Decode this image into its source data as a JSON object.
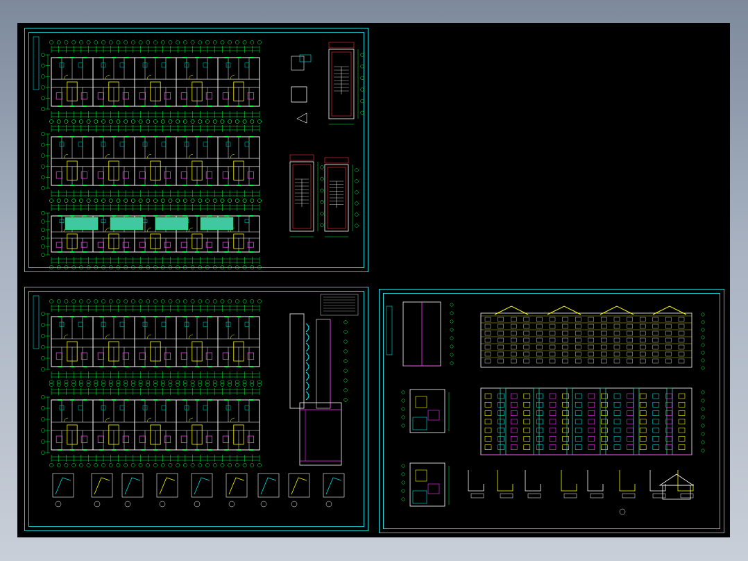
{
  "app": {
    "window": "cad-model-space-viewport",
    "background": "#000000"
  },
  "colors": {
    "wall": "#ffffff",
    "dimension": "#00ff40",
    "axis": "#20d0d8",
    "accent_yellow": "#ffff00",
    "accent_magenta": "#ff30ff",
    "accent_red": "#ff3030",
    "accent_cyan": "#00e0e0",
    "accent_fill": "#40c8a0"
  },
  "sheets": [
    {
      "id": "sheet-floor-plans-a",
      "content": [
        "floor-plan",
        "floor-plan",
        "floor-plan",
        "stair-detail"
      ]
    },
    {
      "id": "sheet-floor-plans-b",
      "content": [
        "floor-plan",
        "floor-plan",
        "wall-section",
        "construction-details"
      ]
    },
    {
      "id": "sheet-elevations",
      "content": [
        "side-elevation",
        "front-elevation",
        "rear-elevation",
        "unit-plans",
        "details"
      ]
    }
  ],
  "elevation": {
    "floors": 7,
    "gables": 4,
    "bays": 16
  },
  "labels": {
    "sheet_a_title": "",
    "sheet_b_title": "",
    "sheet_c_title": ""
  }
}
